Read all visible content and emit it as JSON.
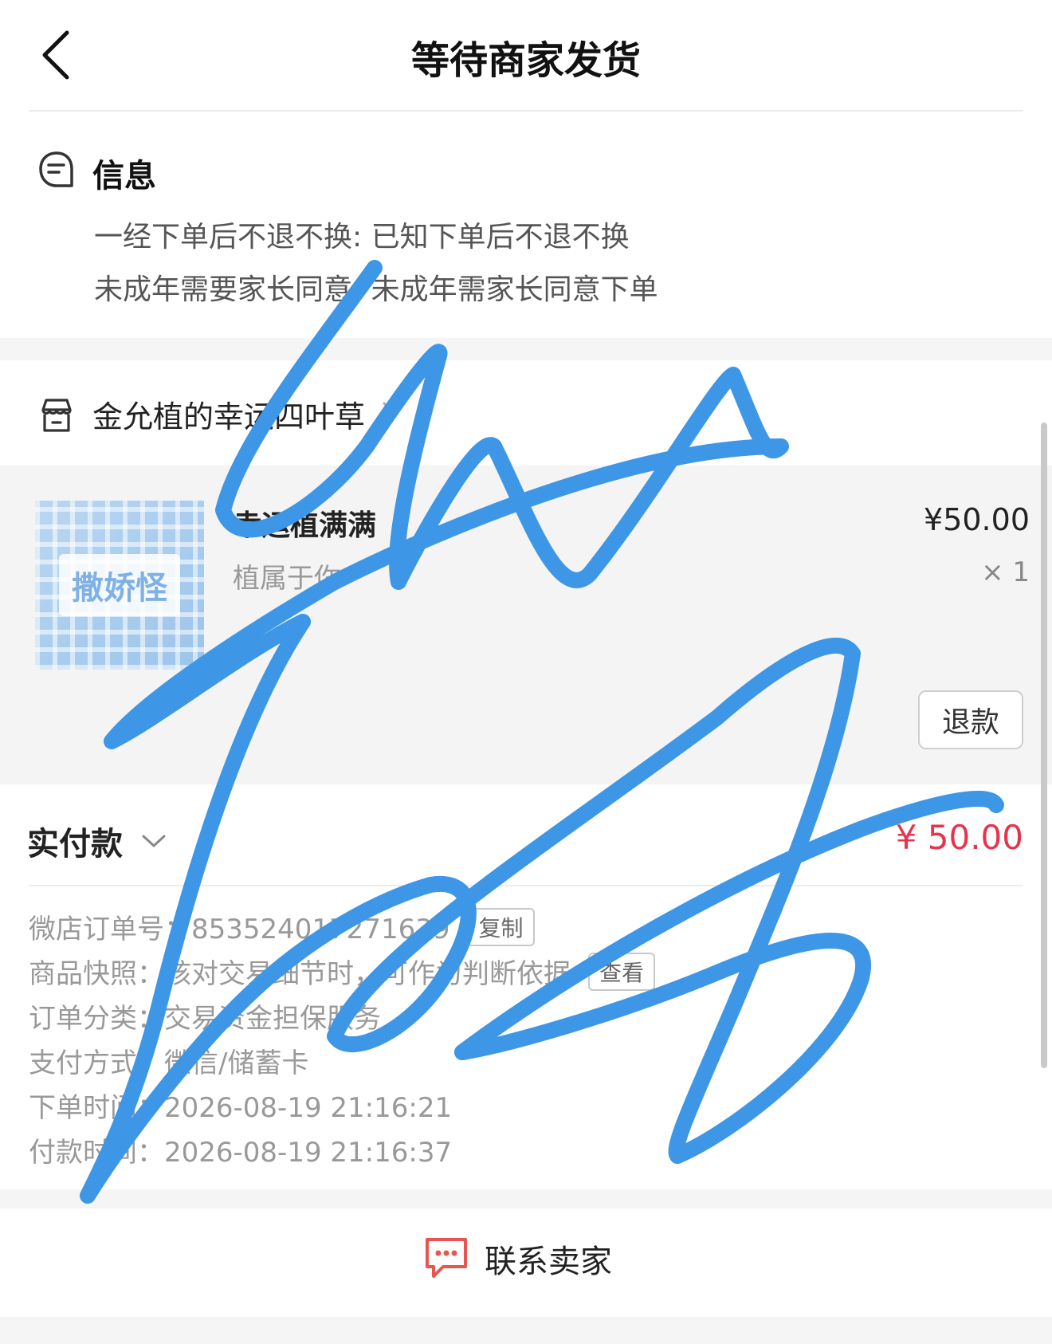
{
  "header": {
    "title": "等待商家发货"
  },
  "info": {
    "title": "信息",
    "lines": [
      "一经下单后不退不换: 已知下单后不退不换",
      "未成年需要家长同意: 未成年需家长同意下单"
    ]
  },
  "shop": {
    "name": "金允植的幸运四叶草"
  },
  "product": {
    "thumbnail_text": "撒娇怪",
    "name": "幸运植满满",
    "subtitle": "植属于你",
    "price": "¥50.00",
    "quantity": "× 1",
    "refund_label": "退款"
  },
  "payment": {
    "label": "实付款",
    "amount": "¥ 50.00",
    "details": [
      {
        "text": "微店订单号：853524017271639",
        "button": "复制"
      },
      {
        "text": "商品快照：核对交易细节时，可作为判断依据",
        "button": "查看"
      },
      {
        "text": "订单分类：交易资金担保服务"
      },
      {
        "text": "支付方式：微信/储蓄卡"
      },
      {
        "text": "下单时间：2026-08-19 21:16:21"
      },
      {
        "text": "付款时间：2026-08-19 21:16:37"
      }
    ]
  },
  "bottom": {
    "contact_label": "联系卖家"
  },
  "colors": {
    "accent": "#e8334d",
    "contact_icon": "#e8554e",
    "scribble": "#3d96e6"
  }
}
